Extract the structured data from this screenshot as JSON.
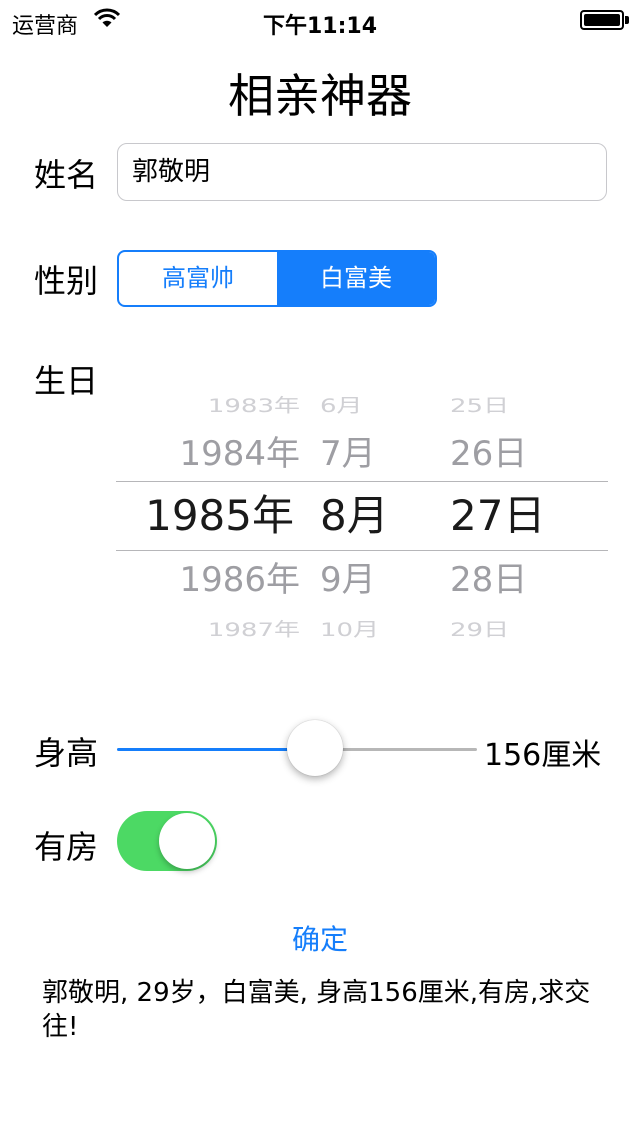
{
  "status_bar": {
    "carrier": "运营商",
    "time": "下午11:14"
  },
  "title": "相亲神器",
  "name": {
    "label": "姓名",
    "value": "郭敬明"
  },
  "gender": {
    "label": "性别",
    "options": [
      "高富帅",
      "白富美"
    ],
    "selected": "白富美"
  },
  "birthday": {
    "label": "生日",
    "years": [
      "1983年",
      "1984年",
      "1985年",
      "1986年",
      "1987年"
    ],
    "months": [
      "6月",
      "7月",
      "8月",
      "9月",
      "10月"
    ],
    "days": [
      "25日",
      "26日",
      "27日",
      "28日",
      "29日"
    ]
  },
  "height": {
    "label": "身高",
    "value_text": "156厘米",
    "slider_fraction": 0.55
  },
  "house": {
    "label": "有房",
    "on": true
  },
  "confirm_label": "确定",
  "result_text": "郭敬明, 29岁，白富美, 身高156厘米,有房,求交往!",
  "colors": {
    "accent": "#157efb",
    "switch_on": "#4cd964",
    "track_off": "#b7b7b7"
  }
}
